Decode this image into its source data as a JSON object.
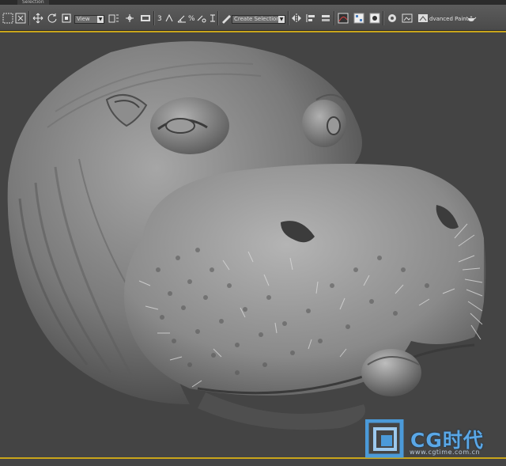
{
  "window": {
    "tab_label": "Selection"
  },
  "toolbar": {
    "reference_dropdown": "View",
    "selection_set_placeholder": "Create Selection Se",
    "advanced_paint_label": "dvanced Paint",
    "num_label": "3",
    "percent_label": "%"
  },
  "viewport": {
    "subject": "hippo"
  },
  "watermark": {
    "brand": "CG时代",
    "url": "www.cgtime.com.cn"
  },
  "colors": {
    "viewport_border": "#c9a51a",
    "viewport_bg": "#444444",
    "watermark": "#5aa7e6"
  }
}
